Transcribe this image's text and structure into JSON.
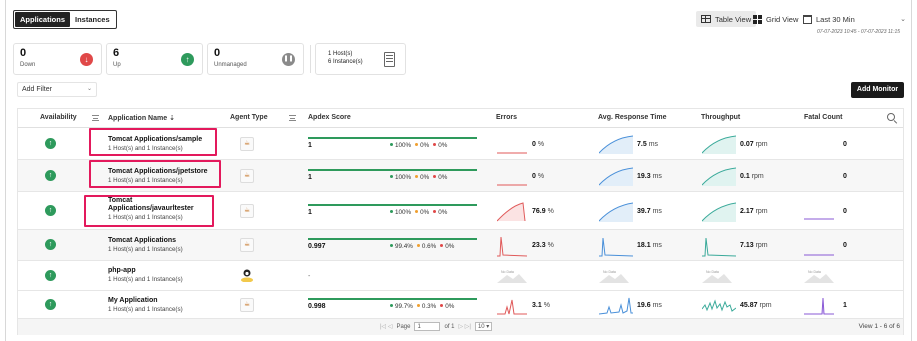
{
  "toggle": {
    "applications": "Applications",
    "instances": "Instances"
  },
  "views": {
    "table": "Table View",
    "grid": "Grid View"
  },
  "time": {
    "selected": "Last 30 Min",
    "range": "07-07-2023 10:45 - 07-07-2023 11:15"
  },
  "summary": {
    "down": {
      "count": "0",
      "label": "Down"
    },
    "up": {
      "count": "6",
      "label": "Up"
    },
    "unmanaged": {
      "count": "0",
      "label": "Unmanaged"
    },
    "hosts": "1 Host(s)",
    "instances": "6 Instance(s)"
  },
  "filter": {
    "label": "Add Filter"
  },
  "add_monitor": "Add Monitor",
  "columns": {
    "availability": "Availability",
    "app_name": "Application Name ⇣",
    "agent_type": "Agent Type",
    "apdex": "Apdex Score",
    "errors": "Errors",
    "art": "Avg. Response Time",
    "throughput": "Throughput",
    "fatal": "Fatal Count"
  },
  "colors": {
    "up": "#2e9a5c",
    "satisfied": "#2e9a5c",
    "tolerating": "#f0a030",
    "frustrated": "#e04848",
    "highlight": "#e3195c",
    "spark_blue": "#4a90d9",
    "spark_red": "#e05a5a",
    "spark_teal": "#3aaa9a",
    "spark_purple": "#8a5ad6"
  },
  "rows": [
    {
      "name": "Tomcat Applications/sample",
      "sub": "1 Host(s) and 1 Instance(s)",
      "agent": "java",
      "apex": "1",
      "satisfied": "100%",
      "tolerating": "0%",
      "frustrated": "0%",
      "errors": "0",
      "errors_unit": "%",
      "art": "7.5",
      "art_unit": "ms",
      "tp": "0.07",
      "tp_unit": "rpm",
      "fatal": "0",
      "highlighted": true
    },
    {
      "name": "Tomcat Applications/jpetstore",
      "sub": "1 Host(s) and 1 Instance(s)",
      "agent": "java",
      "apex": "1",
      "satisfied": "100%",
      "tolerating": "0%",
      "frustrated": "0%",
      "errors": "0",
      "errors_unit": "%",
      "art": "19.3",
      "art_unit": "ms",
      "tp": "0.1",
      "tp_unit": "rpm",
      "fatal": "0",
      "highlighted": true
    },
    {
      "name": "Tomcat Applications/javaurltester",
      "name_line1": "Tomcat",
      "name_line2": "Applications/javaurltester",
      "sub": "1 Host(s) and 1 Instance(s)",
      "agent": "java",
      "apex": "1",
      "satisfied": "100%",
      "tolerating": "0%",
      "frustrated": "0%",
      "errors": "76.9",
      "errors_unit": "%",
      "art": "39.7",
      "art_unit": "ms",
      "tp": "2.17",
      "tp_unit": "rpm",
      "fatal": "0",
      "highlighted": true
    },
    {
      "name": "Tomcat Applications",
      "sub": "1 Host(s) and 1 Instance(s)",
      "agent": "java",
      "apex": "0.997",
      "satisfied": "99.4%",
      "tolerating": "0.6%",
      "frustrated": "0%",
      "errors": "23.3",
      "errors_unit": "%",
      "art": "18.1",
      "art_unit": "ms",
      "tp": "7.13",
      "tp_unit": "rpm",
      "fatal": "0",
      "highlighted": false
    },
    {
      "name": "php-app",
      "sub": "1 Host(s) and 1 Instance(s)",
      "agent": "php",
      "apex": "-",
      "no_data": "No Data",
      "highlighted": false
    },
    {
      "name": "My Application",
      "sub": "1 Host(s) and 1 Instance(s)",
      "agent": "java",
      "apex": "0.998",
      "satisfied": "99.7%",
      "tolerating": "0.3%",
      "frustrated": "0%",
      "errors": "3.1",
      "errors_unit": "%",
      "art": "19.6",
      "art_unit": "ms",
      "tp": "45.87",
      "tp_unit": "rpm",
      "fatal": "1",
      "highlighted": false
    }
  ],
  "pager": {
    "first_prev": "|◁ ◁",
    "page_label": "Page",
    "page_value": "1",
    "of_label": "of 1",
    "next_last": "▷ ▷|",
    "per_page": "10 ▾",
    "view_count": "View 1 - 6 of 6"
  }
}
